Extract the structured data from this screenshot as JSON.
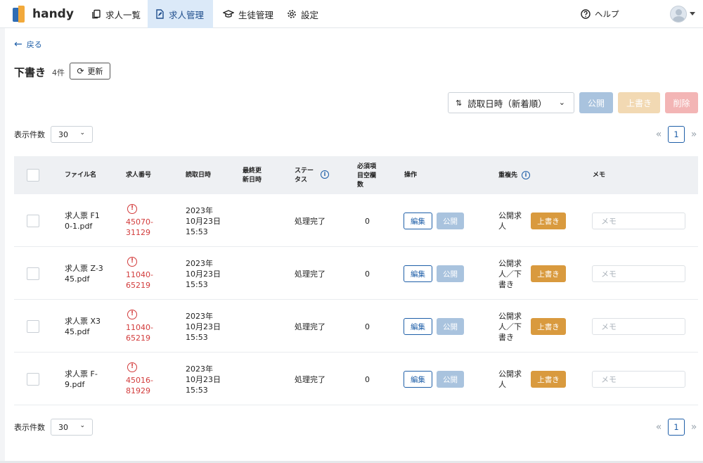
{
  "brand": {
    "name": "handy"
  },
  "nav": [
    {
      "label": "求人一覧",
      "icon": "document-copy-icon"
    },
    {
      "label": "求人管理",
      "icon": "file-edit-icon",
      "active": true
    },
    {
      "label": "生徒管理",
      "icon": "graduation-cap-icon"
    },
    {
      "label": "設定",
      "icon": "gear-icon"
    }
  ],
  "help": {
    "label": "ヘルプ",
    "icon": "question-circle-icon"
  },
  "page": {
    "back_label": "戻る",
    "title": "下書き",
    "count": "4件",
    "refresh_label": "更新"
  },
  "toolbar": {
    "sort_label": "読取日時（新着順）",
    "publish_label": "公開",
    "overwrite_label": "上書き",
    "delete_label": "削除"
  },
  "pagination": {
    "per_page_label": "表示件数",
    "per_page_value": "30",
    "prev": "«",
    "current_page": "1",
    "next": "»"
  },
  "table": {
    "headers": {
      "file": "ファイル名",
      "job_no": "求人番号",
      "read_at": "読取日時",
      "updated_1": "最終更",
      "updated_2": "新日時",
      "status_1": "ステー",
      "status_2": "タス",
      "req_1": "必須項",
      "req_2": "目空欄",
      "req_3": "数",
      "ops": "操作",
      "dup": "重複先",
      "memo": "メモ"
    },
    "rows": [
      {
        "file_1": "求人票 F1",
        "file_2": "0-1.pdf",
        "job_1": "45070-",
        "job_2": "31129",
        "date_1": "2023年",
        "date_2": "10月23日",
        "date_3": "15:53",
        "status": "処理完了",
        "req": "0",
        "edit": "編集",
        "publish": "公開",
        "dup_1": "公開求",
        "dup_2": "人",
        "dup_3": "",
        "overwrite": "上書き",
        "memo_placeholder": "メモ"
      },
      {
        "file_1": "求人票 Z-3",
        "file_2": "45.pdf",
        "job_1": "11040-",
        "job_2": "65219",
        "date_1": "2023年",
        "date_2": "10月23日",
        "date_3": "15:53",
        "status": "処理完了",
        "req": "0",
        "edit": "編集",
        "publish": "公開",
        "dup_1": "公開求",
        "dup_2": "人／下",
        "dup_3": "書き",
        "overwrite": "上書き",
        "memo_placeholder": "メモ"
      },
      {
        "file_1": "求人票 X3",
        "file_2": "45.pdf",
        "job_1": "11040-",
        "job_2": "65219",
        "date_1": "2023年",
        "date_2": "10月23日",
        "date_3": "15:53",
        "status": "処理完了",
        "req": "0",
        "edit": "編集",
        "publish": "公開",
        "dup_1": "公開求",
        "dup_2": "人／下",
        "dup_3": "書き",
        "overwrite": "上書き",
        "memo_placeholder": "メモ"
      },
      {
        "file_1": "求人票 F-",
        "file_2": "9.pdf",
        "job_1": "45016-",
        "job_2": "81929",
        "date_1": "2023年",
        "date_2": "10月23日",
        "date_3": "15:53",
        "status": "処理完了",
        "req": "0",
        "edit": "編集",
        "publish": "公開",
        "dup_1": "公開求",
        "dup_2": "人",
        "dup_3": "",
        "overwrite": "上書き",
        "memo_placeholder": "メモ"
      }
    ]
  },
  "colors": {
    "primary": "#1f5fa8",
    "error": "#d23b3b",
    "overwrite": "#d99a3e",
    "active_nav_bg": "#dbe9f8"
  }
}
